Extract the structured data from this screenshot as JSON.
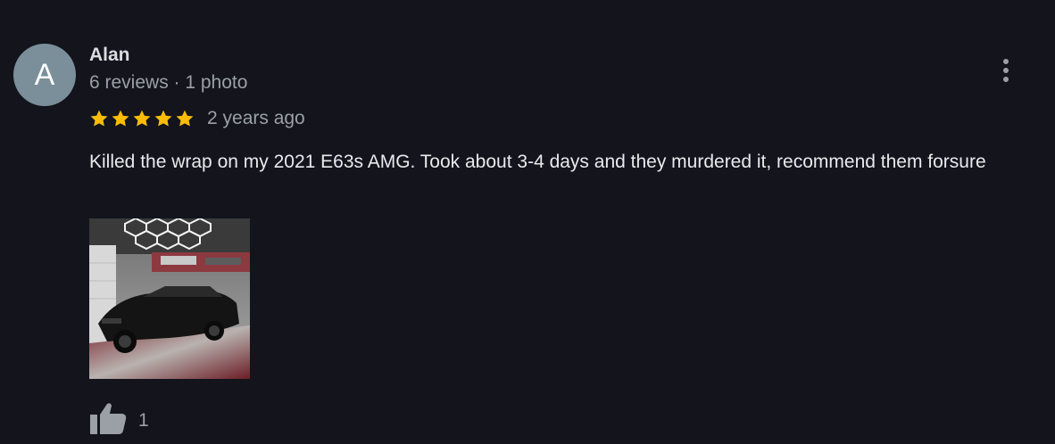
{
  "review": {
    "avatar_letter": "A",
    "author": "Alan",
    "meta": "6 reviews · 1 photo",
    "rating": 5,
    "age": "2 years ago",
    "text": "Killed the wrap on my 2021 E63s AMG. Took about 3-4 days and they murdered it, recommend them forsure",
    "like_count": "1"
  },
  "colors": {
    "background": "#13141c",
    "star": "#fbbc04",
    "avatar": "#7a8f9a"
  },
  "icons": {
    "more": "more-vert-icon",
    "like": "thumbs-up-icon",
    "star": "star-icon"
  }
}
